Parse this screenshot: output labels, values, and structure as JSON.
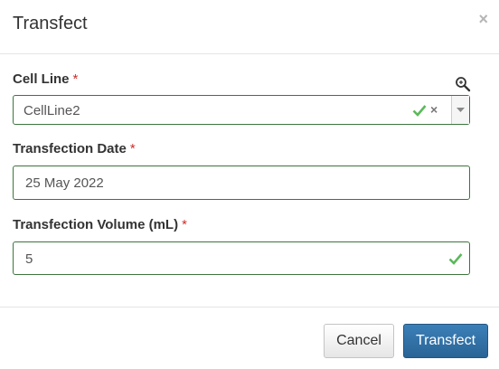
{
  "dialog": {
    "title": "Transfect",
    "close_symbol": "×"
  },
  "form": {
    "cell_line": {
      "label": "Cell Line",
      "required_mark": "*",
      "value": "CellLine2",
      "lookup_icon": "magnifier-icon",
      "clear_symbol": "×"
    },
    "transfection_date": {
      "label": "Transfection Date",
      "required_mark": "*",
      "value": "25 May 2022"
    },
    "transfection_volume": {
      "label": "Transfection Volume (mL)",
      "required_mark": "*",
      "value": "5"
    }
  },
  "footer": {
    "cancel_label": "Cancel",
    "submit_label": "Transfect"
  },
  "colors": {
    "valid_border": "#3c763d",
    "valid_check": "#5cb85c",
    "required": "#c9302c",
    "primary": "#2a6496"
  }
}
